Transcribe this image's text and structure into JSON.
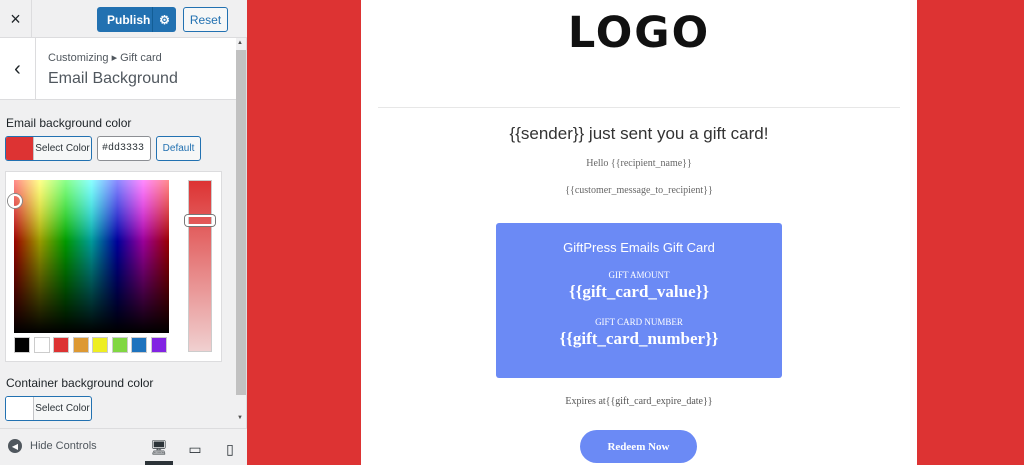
{
  "topbar": {
    "close_icon": "×",
    "publish_label": "Publish",
    "settings_icon": "⚙",
    "reset_label": "Reset"
  },
  "section": {
    "back_icon": "‹",
    "breadcrumb": "Customizing ▸ Gift card",
    "title": "Email Background"
  },
  "email_bg": {
    "label": "Email background color",
    "select_label": "Select Color",
    "value": "#dd3333",
    "default_label": "Default",
    "swatch_color": "#dd3333",
    "palette": [
      "#000000",
      "#ffffff",
      "#dd3333",
      "#dd9933",
      "#eeee22",
      "#81d742",
      "#1e73be",
      "#8224e3"
    ]
  },
  "container_bg": {
    "label": "Container background color",
    "select_label": "Select Color",
    "swatch_color": "#ffffff"
  },
  "bottombar": {
    "hide_icon": "◀",
    "hide_label": "Hide Controls",
    "desktop_icon": "🖥",
    "tablet_icon": "▭",
    "mobile_icon": "▯"
  },
  "preview": {
    "logo": "LOGO",
    "headline": "{{sender}} just sent you a gift card!",
    "hello": "Hello {{recipient_name}}",
    "message": "{{customer_message_to_recipient}}",
    "card_title": "GiftPress Emails Gift Card",
    "amount_label": "GIFT AMOUNT",
    "amount_value": "{{gift_card_value}}",
    "number_label": "GIFT CARD NUMBER",
    "number_value": "{{gift_card_number}}",
    "expires": "Expires at{{gift_card_expire_date}}",
    "redeem_label": "Redeem Now"
  }
}
